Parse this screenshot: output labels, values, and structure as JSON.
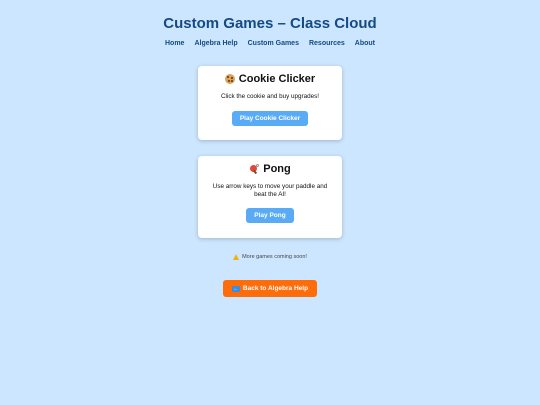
{
  "header": {
    "title": "Custom Games – Class Cloud"
  },
  "nav": {
    "items": [
      {
        "label": "Home"
      },
      {
        "label": "Algebra Help"
      },
      {
        "label": "Custom Games"
      },
      {
        "label": "Resources"
      },
      {
        "label": "About"
      }
    ]
  },
  "games": [
    {
      "icon": "cookie-icon",
      "title": "Cookie Clicker",
      "description": "Click the cookie and buy upgrades!",
      "button_label": "Play Cookie Clicker"
    },
    {
      "icon": "ping-pong-paddle-icon",
      "title": "Pong",
      "description": "Use arrow keys to move your paddle and beat the AI!",
      "button_label": "Play Pong"
    }
  ],
  "notice": {
    "icon": "warning-icon",
    "text": "More games coming soon!"
  },
  "back_button": {
    "icon": "left-arrow-icon",
    "label": "Back to Algebra Help"
  },
  "colors": {
    "background": "#cce6ff",
    "title": "#154a84",
    "play_button": "#5aabf6",
    "back_button": "#ff6d0a"
  }
}
